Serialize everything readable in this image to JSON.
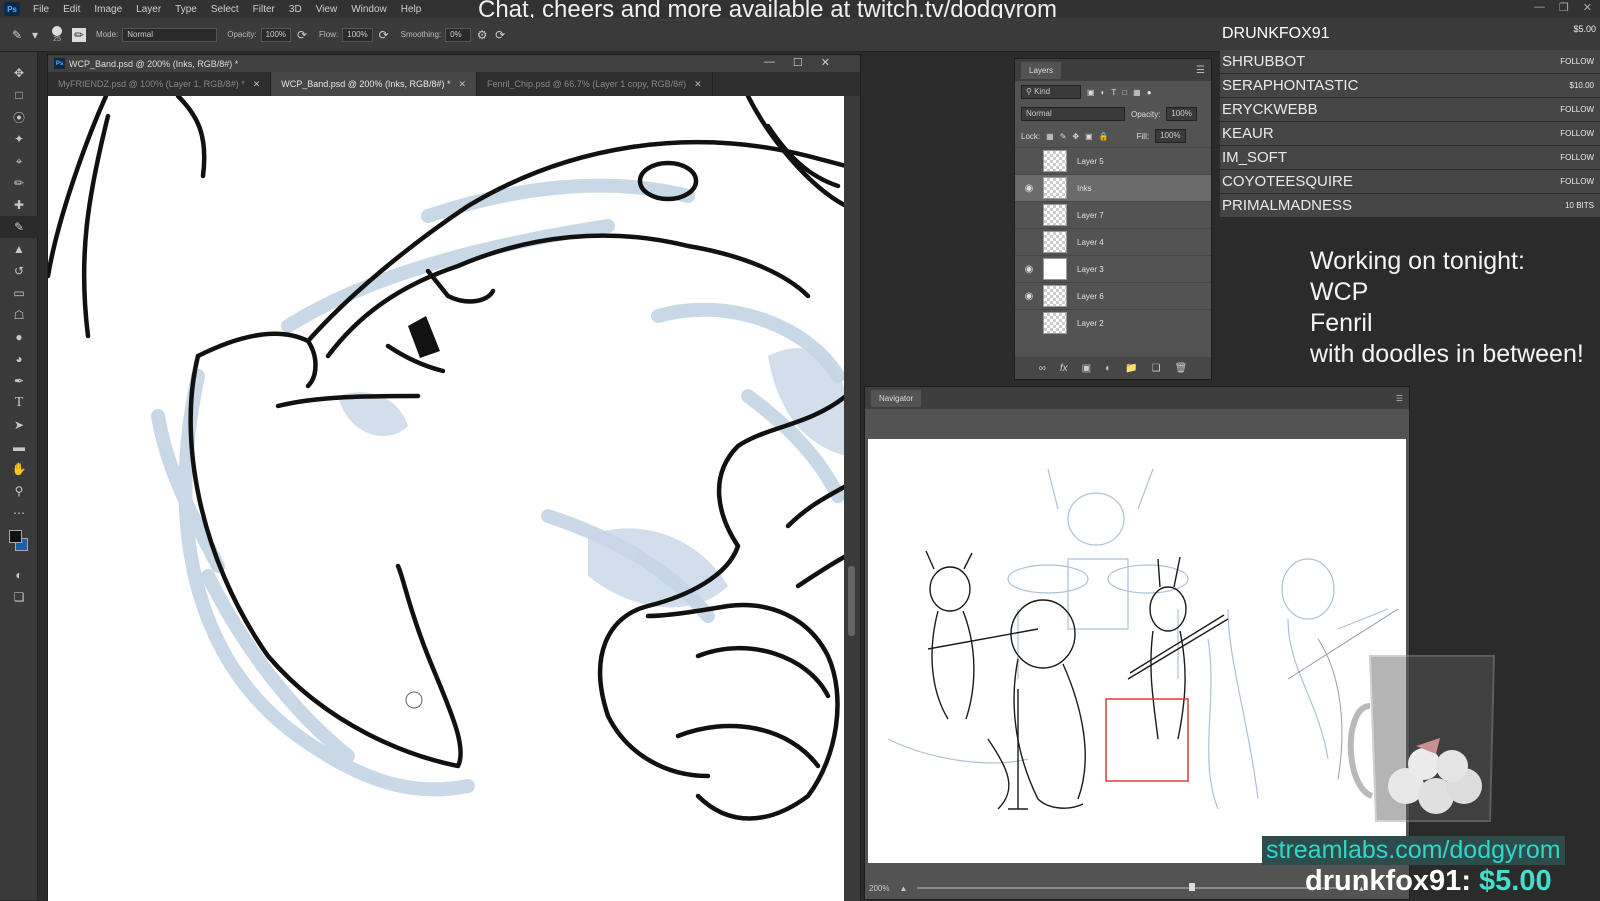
{
  "menubar": {
    "logo": "Ps",
    "items": [
      "File",
      "Edit",
      "Image",
      "Layer",
      "Type",
      "Select",
      "Filter",
      "3D",
      "View",
      "Window",
      "Help"
    ]
  },
  "overlay_title": "Chat, cheers and more available at twitch.tv/dodgyrom",
  "options": {
    "brush_size": "25",
    "mode_label": "Mode:",
    "mode_value": "Normal",
    "opacity_label": "Opacity:",
    "opacity_value": "100%",
    "flow_label": "Flow:",
    "flow_value": "100%",
    "smoothing_label": "Smoothing:",
    "smoothing_value": "0%"
  },
  "document": {
    "title": "WCP_Band.psd @ 200% (Inks, RGB/8#) *",
    "tabs": [
      {
        "label": "MyFRIENDZ.psd @ 100% (Layer 1, RGB/8#) *",
        "active": false
      },
      {
        "label": "WCP_Band.psd @ 200% (Inks, RGB/8#) *",
        "active": true
      },
      {
        "label": "Fenril_Chip.psd @ 66.7% (Layer 1 copy, RGB/8#)",
        "active": false
      }
    ]
  },
  "layers_panel": {
    "tab": "Layers",
    "kind": "Kind",
    "blend": "Normal",
    "opacity_label": "Opacity:",
    "opacity_value": "100%",
    "lock_label": "Lock:",
    "fill_label": "Fill:",
    "fill_value": "100%",
    "layers": [
      {
        "name": "Layer 5",
        "visible": false,
        "active": false,
        "white": false
      },
      {
        "name": "Inks",
        "visible": true,
        "active": true,
        "white": false
      },
      {
        "name": "Layer 7",
        "visible": false,
        "active": false,
        "white": false
      },
      {
        "name": "Layer 4",
        "visible": false,
        "active": false,
        "white": false
      },
      {
        "name": "Layer 3",
        "visible": true,
        "active": false,
        "white": true
      },
      {
        "name": "Layer 6",
        "visible": true,
        "active": false,
        "white": false
      },
      {
        "name": "Layer 2",
        "visible": false,
        "active": false,
        "white": false
      }
    ]
  },
  "navigator": {
    "tab": "Navigator",
    "zoom": "200%"
  },
  "events": {
    "top_name": "DRUNKFOX91",
    "top_amount": "$5.00",
    "items": [
      {
        "name": "SHRUBBOT",
        "action": "FOLLOW"
      },
      {
        "name": "SERAPHONTASTIC",
        "action": "$10.00"
      },
      {
        "name": "ERYCKWEBB",
        "action": "FOLLOW"
      },
      {
        "name": "KEAUR",
        "action": "FOLLOW"
      },
      {
        "name": "IM_SOFT",
        "action": "FOLLOW"
      },
      {
        "name": "COYOTEESQUIRE",
        "action": "FOLLOW"
      },
      {
        "name": "PRIMALMADNESS",
        "action": "10 BITS"
      }
    ]
  },
  "tonight": {
    "line1": "Working on tonight:",
    "line2": "WCP",
    "line3": "Fenril",
    "line4": "with doodles in between!"
  },
  "stream_link": "streamlabs.com/dodgyrom",
  "donation": {
    "name": "drunkfox91:",
    "amount": "$5.00"
  },
  "colors": {
    "accent_teal": "#2fd7c8",
    "sketch_blue": "#b8cbe0",
    "nav_frame": "#e03a3a"
  },
  "toolbar_icons": [
    "move-icon",
    "marquee-icon",
    "lasso-icon",
    "magic-wand-icon",
    "crop-icon",
    "eyedropper-icon",
    "healing-icon",
    "brush-icon",
    "stamp-icon",
    "history-brush-icon",
    "eraser-icon",
    "bucket-icon",
    "blur-icon",
    "dodge-icon",
    "pen-icon",
    "type-icon",
    "path-select-icon",
    "shape-icon",
    "hand-icon",
    "zoom-icon",
    "more-icon"
  ]
}
